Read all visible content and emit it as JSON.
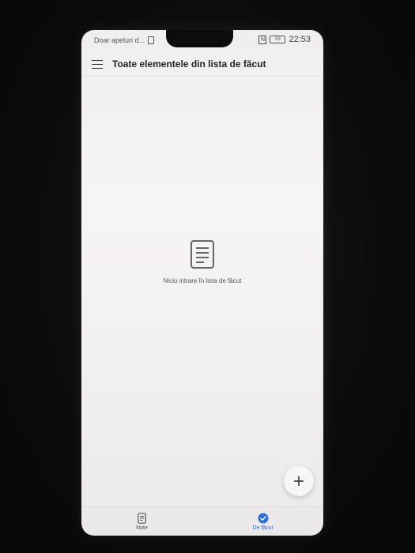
{
  "status_bar": {
    "carrier_text": "Doar apeluri d...",
    "nfc_label": "N",
    "battery_label": "59",
    "time": "22:53"
  },
  "app_bar": {
    "title": "Toate elementele din lista de făcut"
  },
  "empty_state": {
    "message": "Nicio intrare în lista de făcut"
  },
  "bottom_nav": {
    "tabs": [
      {
        "label": "Note",
        "icon": "note-icon",
        "active": false
      },
      {
        "label": "De făcut",
        "icon": "check-circle-icon",
        "active": true
      }
    ]
  },
  "colors": {
    "accent": "#2a6fdb",
    "background": "#f4f1f3",
    "icon_gray": "#666666"
  }
}
